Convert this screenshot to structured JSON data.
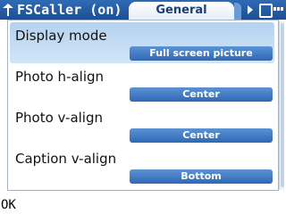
{
  "titlebar": {
    "app_title": "FSCaller (on)",
    "tab_label": "General",
    "icons": [
      "signal-icon",
      "tab-next-arrow-icon",
      "status-icon",
      "battery-icon"
    ]
  },
  "settings": {
    "items": [
      {
        "label": "Display mode",
        "value": "Full screen picture",
        "selected": true
      },
      {
        "label": "Photo h-align",
        "value": "Center",
        "selected": false
      },
      {
        "label": "Photo v-align",
        "value": "Center",
        "selected": false
      },
      {
        "label": "Caption v-align",
        "value": "Bottom",
        "selected": false
      }
    ]
  },
  "softkeys": {
    "left": "OK"
  },
  "colors": {
    "titlebar": "#1b4f96",
    "selection": "#b3d2f0",
    "value_chip": "#2f69b5"
  }
}
